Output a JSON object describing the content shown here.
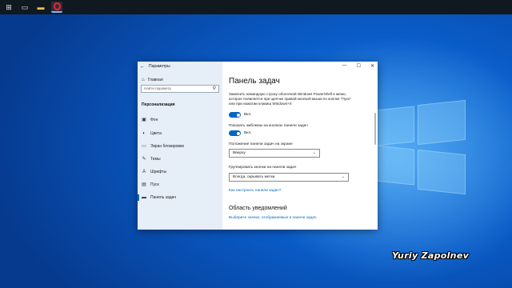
{
  "taskbar": {
    "icons": [
      "start-icon",
      "task-view-icon",
      "file-explorer-icon",
      "opera-icon"
    ]
  },
  "window": {
    "title": "Параметры",
    "search_placeholder": "Найти параметр",
    "home_label": "Главная",
    "section_title": "Персонализация",
    "nav": [
      {
        "label": "Фон",
        "icon": "picture-icon"
      },
      {
        "label": "Цвета",
        "icon": "palette-icon"
      },
      {
        "label": "Экран блокировки",
        "icon": "lock-screen-icon"
      },
      {
        "label": "Темы",
        "icon": "brush-icon"
      },
      {
        "label": "Шрифты",
        "icon": "font-icon"
      },
      {
        "label": "Пуск",
        "icon": "start-menu-icon"
      },
      {
        "label": "Панель задач",
        "icon": "taskbar-icon",
        "active": true
      }
    ]
  },
  "content": {
    "page_title": "Панель задач",
    "powershell_desc": "Заменить командную строку оболочкой Windows PowerShell в меню, которое появляется при щелчке правой кнопкой мыши по кнопке \"Пуск\" или при нажатии клавиш Windows+X",
    "toggle1_state": "Вкл.",
    "badges_label": "Показать эмблемы на кнопках панели задач",
    "toggle2_state": "Вкл.",
    "position_label": "Положение панели задач на экране",
    "position_value": "Вверху",
    "grouping_label": "Группировать кнопки на панели задач",
    "grouping_value": "Всегда, скрывать метки",
    "customize_link": "Как настроить панели задач?",
    "notif_heading": "Область уведомлений",
    "notif_link": "Выберите значки, отображаемые в панели задач"
  },
  "colors": {
    "accent": "#0067c0",
    "sidebar_bg": "#e6eef7",
    "desktop_blue": "#0a5cc8"
  },
  "watermark": "Yuriy Zapolnev"
}
